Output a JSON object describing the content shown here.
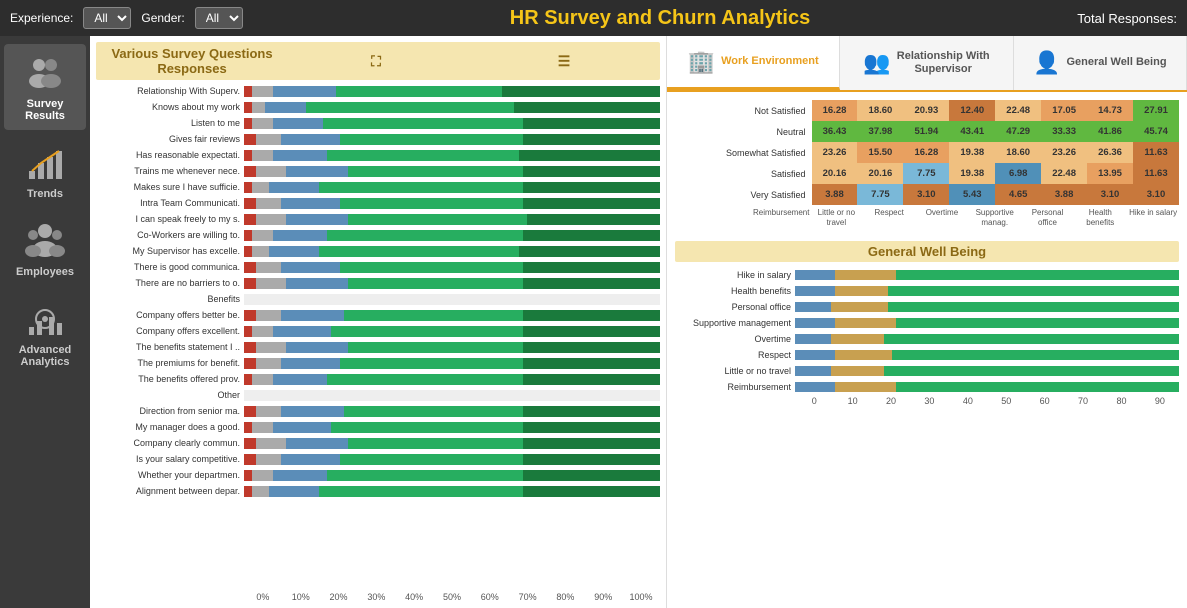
{
  "topbar": {
    "experience_label": "Experience:",
    "experience_value": "All",
    "gender_label": "Gender:",
    "gender_value": "All",
    "title": "HR Survey and Churn Analytics",
    "total_label": "Total Responses:"
  },
  "sidebar": {
    "items": [
      {
        "id": "survey-results",
        "label": "Survey Results",
        "active": true,
        "icon": "people"
      },
      {
        "id": "trends",
        "label": "Trends",
        "active": false,
        "icon": "chart"
      },
      {
        "id": "employees",
        "label": "Employees",
        "active": false,
        "icon": "people2"
      },
      {
        "id": "advanced",
        "label": "Advanced Analytics",
        "active": false,
        "icon": "gear-chart"
      }
    ]
  },
  "survey_chart": {
    "title": "Various Survey Questions Responses",
    "bars": [
      {
        "label": "Relationship With Superv.",
        "red": 2,
        "gray": 5,
        "blue": 15,
        "green": 40,
        "dkgreen": 38
      },
      {
        "label": "Knows about my work",
        "red": 2,
        "gray": 3,
        "blue": 10,
        "green": 50,
        "dkgreen": 35
      },
      {
        "label": "Listen to me",
        "red": 2,
        "gray": 5,
        "blue": 12,
        "green": 48,
        "dkgreen": 33
      },
      {
        "label": "Gives fair reviews",
        "red": 3,
        "gray": 6,
        "blue": 14,
        "green": 44,
        "dkgreen": 33
      },
      {
        "label": "Has reasonable expectati.",
        "red": 2,
        "gray": 5,
        "blue": 13,
        "green": 46,
        "dkgreen": 34
      },
      {
        "label": "Trains me whenever nece.",
        "red": 3,
        "gray": 7,
        "blue": 15,
        "green": 42,
        "dkgreen": 33
      },
      {
        "label": "Makes sure I have sufficie.",
        "red": 2,
        "gray": 4,
        "blue": 12,
        "green": 49,
        "dkgreen": 33
      },
      {
        "label": "Intra Team Communicati.",
        "red": 3,
        "gray": 6,
        "blue": 14,
        "green": 44,
        "dkgreen": 33
      },
      {
        "label": "I can speak freely to my s.",
        "red": 3,
        "gray": 7,
        "blue": 15,
        "green": 43,
        "dkgreen": 32
      },
      {
        "label": "Co-Workers are willing to.",
        "red": 2,
        "gray": 5,
        "blue": 13,
        "green": 47,
        "dkgreen": 33
      },
      {
        "label": "My Supervisor has excelle.",
        "red": 2,
        "gray": 4,
        "blue": 12,
        "green": 48,
        "dkgreen": 34
      },
      {
        "label": "There is good communica.",
        "red": 3,
        "gray": 6,
        "blue": 14,
        "green": 44,
        "dkgreen": 33
      },
      {
        "label": "There are no barriers to o.",
        "red": 3,
        "gray": 7,
        "blue": 15,
        "green": 42,
        "dkgreen": 33
      },
      {
        "label": "Benefits",
        "red": 0,
        "gray": 0,
        "blue": 0,
        "green": 0,
        "dkgreen": 0
      },
      {
        "label": "Company offers better be.",
        "red": 3,
        "gray": 6,
        "blue": 15,
        "green": 43,
        "dkgreen": 33
      },
      {
        "label": "Company offers excellent.",
        "red": 2,
        "gray": 5,
        "blue": 14,
        "green": 46,
        "dkgreen": 33
      },
      {
        "label": "The benefits statement I ..",
        "red": 3,
        "gray": 7,
        "blue": 15,
        "green": 42,
        "dkgreen": 33
      },
      {
        "label": "The premiums for benefit.",
        "red": 3,
        "gray": 6,
        "blue": 14,
        "green": 44,
        "dkgreen": 33
      },
      {
        "label": "The benefits offered prov.",
        "red": 2,
        "gray": 5,
        "blue": 13,
        "green": 47,
        "dkgreen": 33
      },
      {
        "label": "Other",
        "red": 0,
        "gray": 0,
        "blue": 0,
        "green": 0,
        "dkgreen": 0
      },
      {
        "label": "Direction from senior ma.",
        "red": 3,
        "gray": 6,
        "blue": 15,
        "green": 43,
        "dkgreen": 33
      },
      {
        "label": "My manager does a good.",
        "red": 2,
        "gray": 5,
        "blue": 14,
        "green": 46,
        "dkgreen": 33
      },
      {
        "label": "Company clearly commun.",
        "red": 3,
        "gray": 7,
        "blue": 15,
        "green": 42,
        "dkgreen": 33
      },
      {
        "label": "Is your salary competitive.",
        "red": 3,
        "gray": 6,
        "blue": 14,
        "green": 44,
        "dkgreen": 33
      },
      {
        "label": "Whether your departmen.",
        "red": 2,
        "gray": 5,
        "blue": 13,
        "green": 47,
        "dkgreen": 33
      },
      {
        "label": "Alignment between depar.",
        "red": 2,
        "gray": 4,
        "blue": 12,
        "green": 49,
        "dkgreen": 33
      }
    ],
    "x_labels": [
      "0%",
      "10%",
      "20%",
      "30%",
      "40%",
      "50%",
      "60%",
      "70%",
      "80%",
      "90%",
      "100%"
    ]
  },
  "right_tabs": [
    {
      "id": "work-env",
      "label": "Work Environment",
      "active": true,
      "icon": "🏢"
    },
    {
      "id": "rel-supervisor",
      "label": "Relationship With\nSupervisor",
      "active": false,
      "icon": "👥"
    },
    {
      "id": "general-wellbeing",
      "label": "General Well Being",
      "active": false,
      "icon": "👤"
    }
  ],
  "heatmap": {
    "rows": [
      {
        "label": "Not Satisfied",
        "values": [
          "16.28",
          "18.60",
          "20.93",
          "12.40",
          "22.48",
          "17.05",
          "14.73",
          "27.91"
        ]
      },
      {
        "label": "Neutral",
        "values": [
          "36.43",
          "37.98",
          "51.94",
          "43.41",
          "47.29",
          "33.33",
          "41.86",
          "45.74"
        ]
      },
      {
        "label": "Somewhat Satisfied",
        "values": [
          "23.26",
          "15.50",
          "16.28",
          "19.38",
          "18.60",
          "23.26",
          "26.36",
          "11.63"
        ]
      },
      {
        "label": "Satisfied",
        "values": [
          "20.16",
          "20.16",
          "7.75",
          "19.38",
          "6.98",
          "22.48",
          "13.95",
          "11.63"
        ]
      },
      {
        "label": "Very Satisfied",
        "values": [
          "3.88",
          "7.75",
          "3.10",
          "5.43",
          "4.65",
          "3.88",
          "3.10",
          "3.10"
        ]
      }
    ],
    "col_labels": [
      "Reimbursement",
      "Little or no travel",
      "Respect",
      "Overtime",
      "Supportive manag.",
      "Personal office",
      "Health benefits",
      "Hike in salary"
    ]
  },
  "gwb": {
    "title": "General Well Being",
    "bars": [
      {
        "label": "Hike in salary",
        "blue": 10,
        "tan": 15,
        "green": 70
      },
      {
        "label": "Health benefits",
        "blue": 10,
        "tan": 13,
        "green": 72
      },
      {
        "label": "Personal office",
        "blue": 9,
        "tan": 14,
        "green": 72
      },
      {
        "label": "Supportive management",
        "blue": 10,
        "tan": 15,
        "green": 70
      },
      {
        "label": "Overtime",
        "blue": 9,
        "tan": 13,
        "green": 73
      },
      {
        "label": "Respect",
        "blue": 10,
        "tan": 14,
        "green": 71
      },
      {
        "label": "Little or no travel",
        "blue": 9,
        "tan": 13,
        "green": 73
      },
      {
        "label": "Reimbursement",
        "blue": 10,
        "tan": 15,
        "green": 70
      }
    ],
    "x_labels": [
      "0",
      "10",
      "20",
      "30",
      "40",
      "50",
      "60",
      "70",
      "80",
      "90"
    ]
  },
  "colors": {
    "accent": "#e8a020",
    "sidebar_bg": "#3a3a3a",
    "topbar_bg": "#2d2d2d"
  }
}
